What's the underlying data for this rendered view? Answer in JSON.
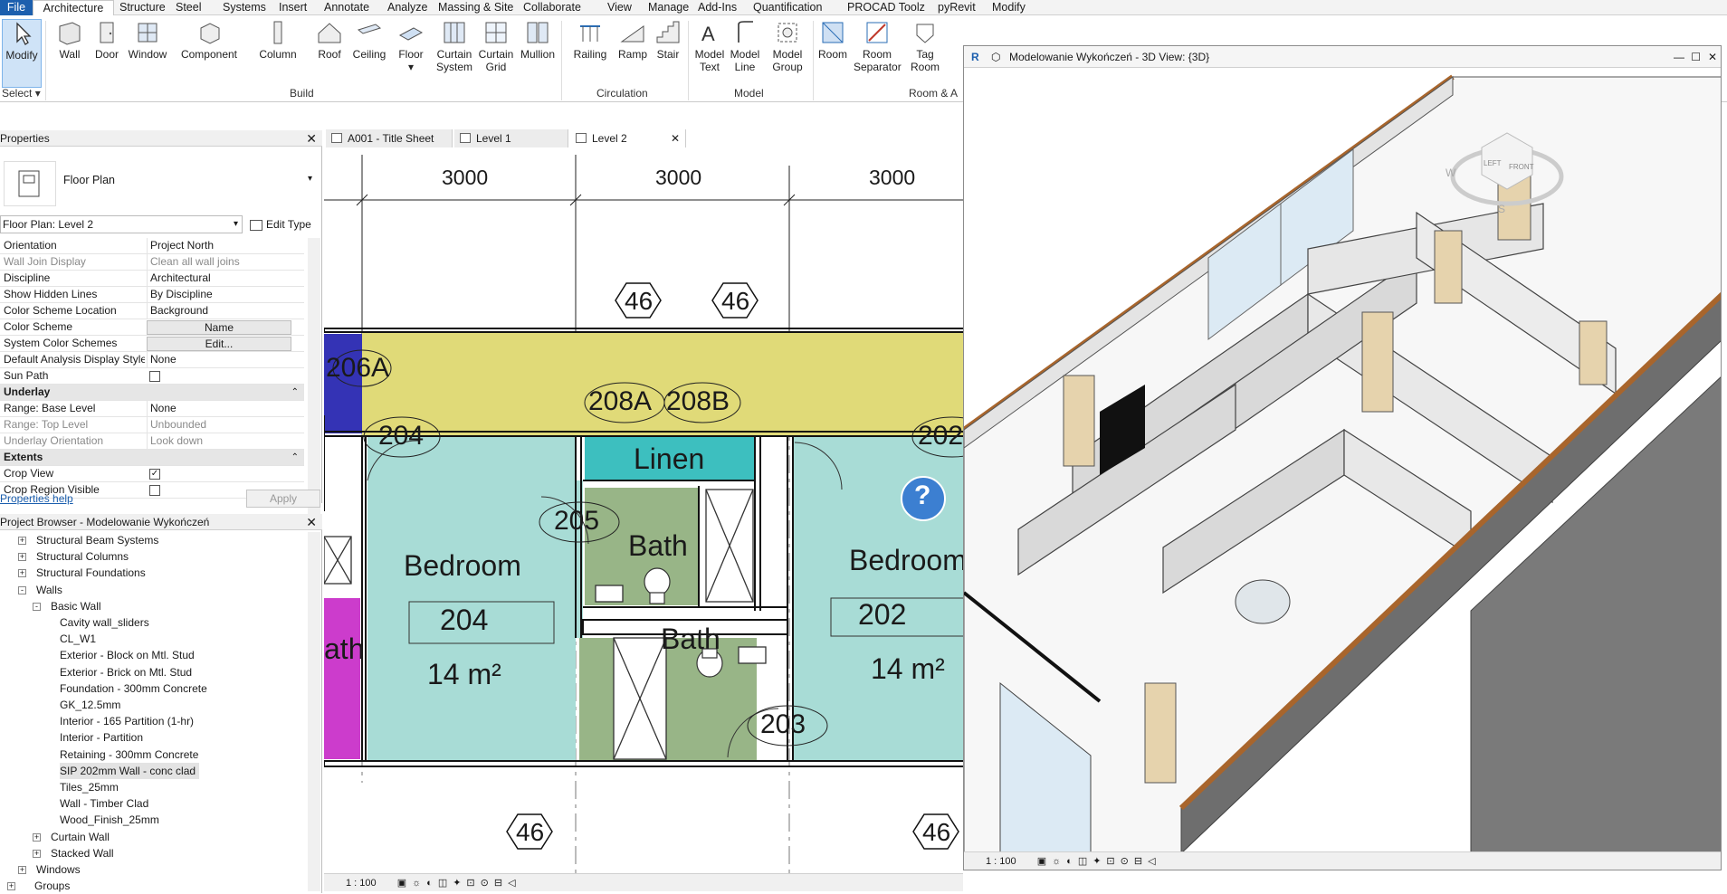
{
  "ribbon_tabs": [
    "File",
    "Architecture",
    "Structure",
    "Steel",
    "Systems",
    "Insert",
    "Annotate",
    "Analyze",
    "Massing & Site",
    "Collaborate",
    "View",
    "Manage",
    "Add-Ins",
    "Quantification",
    "PROCAD Toolz",
    "pyRevit",
    "Modify"
  ],
  "ribbon": {
    "modify": "Modify",
    "select": "Select",
    "build": [
      "Wall",
      "Door",
      "Window",
      "Component",
      "Column",
      "Roof",
      "Ceiling",
      "Floor"
    ],
    "curtain_system": [
      "Curtain",
      "System"
    ],
    "curtain_grid": [
      "Curtain",
      "Grid"
    ],
    "mullion": "Mullion",
    "circulation": [
      "Railing",
      "Ramp",
      "Stair"
    ],
    "model": [
      [
        "Model",
        "Text"
      ],
      [
        "Model",
        "Line"
      ],
      [
        "Model",
        "Group"
      ]
    ],
    "room": "Room",
    "room_separator": [
      "Room",
      "Separator"
    ],
    "tag_room": [
      "Tag",
      "Room"
    ],
    "panels": {
      "build": "Build",
      "circulation": "Circulation",
      "model": "Model",
      "room": "Room & A"
    }
  },
  "properties": {
    "title": "Properties",
    "type_name": "Floor Plan",
    "instance": "Floor Plan: Level 2",
    "edit_type": "Edit Type",
    "help": "Properties help",
    "apply": "Apply",
    "rows": [
      {
        "k": "Orientation",
        "v": "Project North"
      },
      {
        "k": "Wall Join Display",
        "v": "Clean all wall joins",
        "grey": true
      },
      {
        "k": "Discipline",
        "v": "Architectural"
      },
      {
        "k": "Show Hidden Lines",
        "v": "By Discipline"
      },
      {
        "k": "Color Scheme Location",
        "v": "Background"
      },
      {
        "k": "Color Scheme",
        "btn": "Name"
      },
      {
        "k": "System Color Schemes",
        "btn": "Edit..."
      },
      {
        "k": "Default Analysis Display Style",
        "v": "None"
      },
      {
        "k": "Sun Path",
        "check": false
      },
      {
        "group": "Underlay"
      },
      {
        "k": "Range: Base Level",
        "v": "None"
      },
      {
        "k": "Range: Top Level",
        "v": "Unbounded",
        "grey": true
      },
      {
        "k": "Underlay Orientation",
        "v": "Look down",
        "grey": true
      },
      {
        "group": "Extents"
      },
      {
        "k": "Crop View",
        "check": true
      },
      {
        "k": "Crop Region Visible",
        "check": false
      }
    ]
  },
  "browser": {
    "title": "Project Browser - Modelowanie Wykończeń",
    "items": [
      {
        "t": "Structural Beam Systems",
        "lvl": 1,
        "exp": "+"
      },
      {
        "t": "Structural Columns",
        "lvl": 1,
        "exp": "+"
      },
      {
        "t": "Structural Foundations",
        "lvl": 1,
        "exp": "+"
      },
      {
        "t": "Walls",
        "lvl": 1,
        "exp": "-"
      },
      {
        "t": "Basic Wall",
        "lvl": 2,
        "exp": "-"
      },
      {
        "t": "Cavity wall_sliders",
        "lvl": 3
      },
      {
        "t": "CL_W1",
        "lvl": 3
      },
      {
        "t": "Exterior - Block on Mtl. Stud",
        "lvl": 3
      },
      {
        "t": "Exterior - Brick on Mtl. Stud",
        "lvl": 3
      },
      {
        "t": "Foundation - 300mm Concrete",
        "lvl": 3
      },
      {
        "t": "GK_12.5mm",
        "lvl": 3
      },
      {
        "t": "Interior - 165 Partition (1-hr)",
        "lvl": 3
      },
      {
        "t": "Interior - Partition",
        "lvl": 3
      },
      {
        "t": "Retaining - 300mm Concrete",
        "lvl": 3
      },
      {
        "t": "SIP 202mm Wall - conc clad",
        "lvl": 3,
        "sel": true
      },
      {
        "t": "Tiles_25mm",
        "lvl": 3
      },
      {
        "t": "Wall - Timber Clad",
        "lvl": 3
      },
      {
        "t": "Wood_Finish_25mm",
        "lvl": 3
      },
      {
        "t": "Curtain Wall",
        "lvl": 2,
        "exp": "+"
      },
      {
        "t": "Stacked Wall",
        "lvl": 2,
        "exp": "+"
      },
      {
        "t": "Windows",
        "lvl": 1,
        "exp": "+"
      },
      {
        "t": "Groups",
        "lvl": 0,
        "exp": "+"
      }
    ]
  },
  "view_tabs": [
    "A001 - Title Sheet",
    "Level 1",
    "Level 2"
  ],
  "plan": {
    "dims": [
      "3000",
      "3000",
      "3000"
    ],
    "grid_tags": [
      "46",
      "46",
      "46",
      "46"
    ],
    "room_tags": [
      "206A",
      "204",
      "208A",
      "208B",
      "205",
      "202",
      "203"
    ],
    "room_names": [
      "Linen",
      "Bath",
      "Bedroom",
      "Bath",
      "Bedroom",
      "ath"
    ],
    "room_numbers": [
      "204",
      "202"
    ],
    "areas": [
      "14 m²",
      "14 m²"
    ],
    "help": "?",
    "scale": "1 : 100"
  },
  "view3d": {
    "title": "Modelowanie Wykończeń - 3D View: {3D}",
    "scale": "1 : 100",
    "app_badge": "R",
    "cube_left": "LEFT",
    "cube_front": "FRONT",
    "compass_w": "W",
    "compass_s": "S"
  },
  "colors": {
    "accent": "#1c5fae",
    "linen": "#3dbfbf",
    "yellow": "#e0da78",
    "bedroom": "#a8dcd6",
    "bath": "#98b587",
    "magenta": "#cc3ccc",
    "navy": "#3433b5"
  }
}
